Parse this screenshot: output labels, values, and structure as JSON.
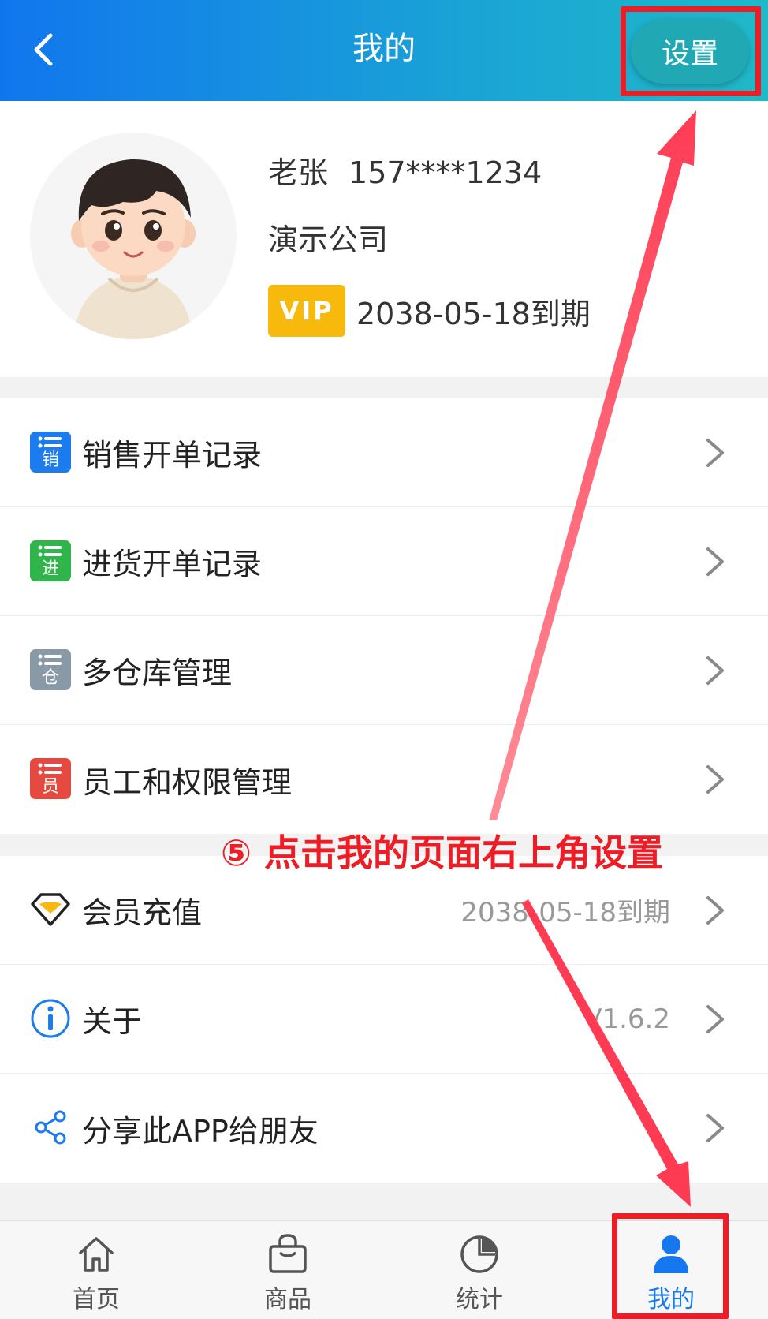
{
  "header": {
    "title": "我的",
    "settings_label": "设置"
  },
  "profile": {
    "name": "老张",
    "phone": "157****1234",
    "company": "演示公司",
    "vip_badge": "VIP",
    "vip_expire": "2038-05-18到期"
  },
  "menu_primary": [
    {
      "label": "销售开单记录",
      "icon": "sales-list-icon",
      "icon_char": "销",
      "color": "#1b7cf0"
    },
    {
      "label": "进货开单记录",
      "icon": "purchase-list-icon",
      "icon_char": "进",
      "color": "#2fb54a"
    },
    {
      "label": "多仓库管理",
      "icon": "warehouse-list-icon",
      "icon_char": "仓",
      "color": "#8a99a6"
    },
    {
      "label": "员工和权限管理",
      "icon": "staff-list-icon",
      "icon_char": "员",
      "color": "#e5493f"
    }
  ],
  "menu_secondary": [
    {
      "label": "会员充值",
      "value": "2038-05-18到期",
      "icon": "diamond-icon"
    },
    {
      "label": "关于",
      "value": "V1.6.2",
      "icon": "info-icon"
    },
    {
      "label": "分享此APP给朋友",
      "value": "",
      "icon": "share-icon"
    }
  ],
  "tabbar": [
    {
      "label": "首页",
      "icon": "home-icon",
      "active": false
    },
    {
      "label": "商品",
      "icon": "bag-icon",
      "active": false
    },
    {
      "label": "统计",
      "icon": "pie-chart-icon",
      "active": false
    },
    {
      "label": "我的",
      "icon": "user-icon",
      "active": true
    }
  ],
  "annotation": {
    "text": "⑤ 点击我的页面右上角设置",
    "color": "#ee1c24"
  },
  "colors": {
    "accent": "#1678f0",
    "vip": "#f7b90c",
    "annotation": "#ee1c24"
  }
}
